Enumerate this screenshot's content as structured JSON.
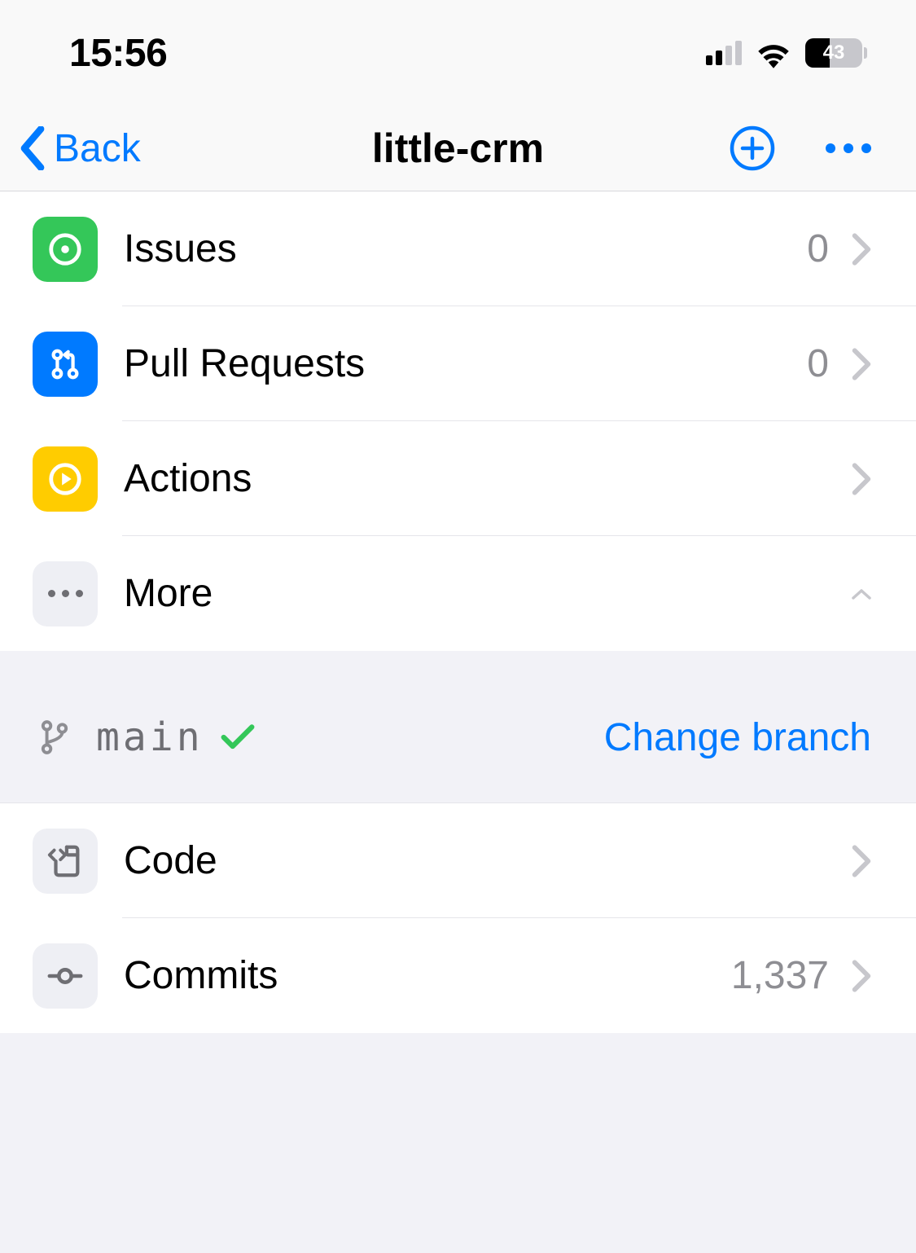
{
  "status": {
    "time": "15:56",
    "battery_pct": "43"
  },
  "nav": {
    "back_label": "Back",
    "title": "little-crm"
  },
  "rows": {
    "issues": {
      "label": "Issues",
      "count": "0"
    },
    "pulls": {
      "label": "Pull Requests",
      "count": "0"
    },
    "actions": {
      "label": "Actions"
    },
    "more": {
      "label": "More"
    },
    "code": {
      "label": "Code"
    },
    "commits": {
      "label": "Commits",
      "count": "1,337"
    }
  },
  "branch": {
    "name": "main",
    "change_label": "Change branch"
  }
}
